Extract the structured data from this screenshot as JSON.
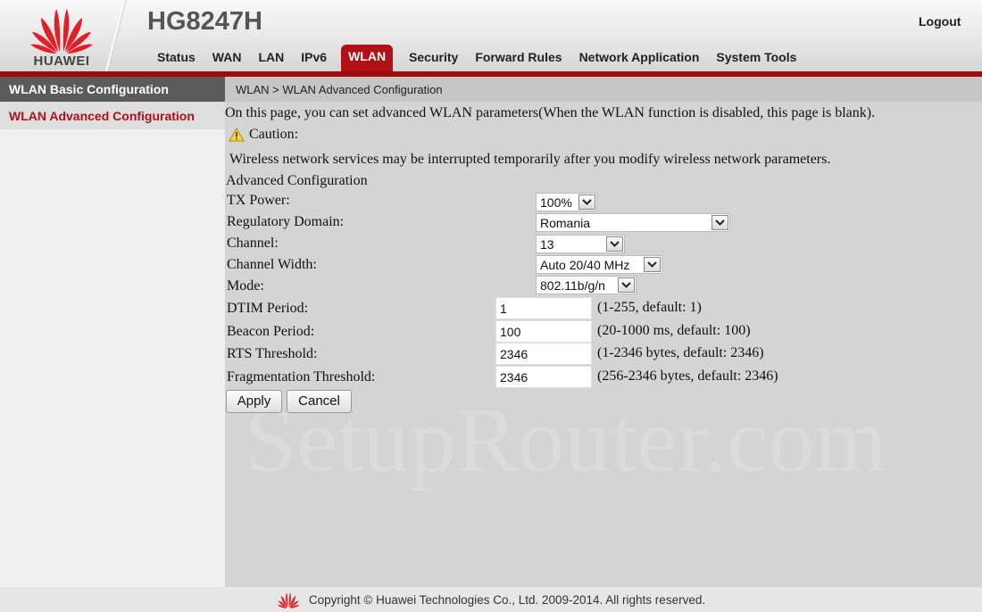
{
  "header": {
    "brand": "HUAWEI",
    "model": "HG8247H",
    "logout_label": "Logout"
  },
  "nav": {
    "items": [
      {
        "label": "Status",
        "active": false
      },
      {
        "label": "WAN",
        "active": false
      },
      {
        "label": "LAN",
        "active": false
      },
      {
        "label": "IPv6",
        "active": false
      },
      {
        "label": "WLAN",
        "active": true
      },
      {
        "label": "Security",
        "active": false
      },
      {
        "label": "Forward Rules",
        "active": false
      },
      {
        "label": "Network Application",
        "active": false
      },
      {
        "label": "System Tools",
        "active": false
      }
    ]
  },
  "sidebar": {
    "items": [
      {
        "label": "WLAN Basic Configuration"
      },
      {
        "label": "WLAN Advanced Configuration",
        "selected": true
      }
    ]
  },
  "breadcrumb": "WLAN > WLAN Advanced Configuration",
  "page": {
    "intro": "On this page, you can set advanced WLAN parameters(When the WLAN function is disabled, this page is blank).",
    "caution_label": "Caution:",
    "caution_icon": "warning-triangle-icon",
    "caution_text": "Wireless network services may be interrupted temporarily after you modify wireless network parameters.",
    "section_title": "Advanced Configuration"
  },
  "form": {
    "tx_power": {
      "label": "TX Power:",
      "value": "100%"
    },
    "regulatory_domain": {
      "label": "Regulatory Domain:",
      "value": "Romania"
    },
    "channel": {
      "label": "Channel:",
      "value": "13"
    },
    "channel_width": {
      "label": "Channel Width:",
      "value": "Auto 20/40 MHz"
    },
    "mode": {
      "label": "Mode:",
      "value": "802.11b/g/n"
    },
    "dtim_period": {
      "label": "DTIM Period:",
      "value": "1",
      "hint": "(1-255, default: 1)"
    },
    "beacon_period": {
      "label": "Beacon Period:",
      "value": "100",
      "hint": "(20-1000 ms, default: 100)"
    },
    "rts_threshold": {
      "label": "RTS Threshold:",
      "value": "2346",
      "hint": "(1-2346 bytes, default: 2346)"
    },
    "frag_threshold": {
      "label": "Fragmentation Threshold:",
      "value": "2346",
      "hint": "(256-2346 bytes, default: 2346)"
    },
    "apply_label": "Apply",
    "cancel_label": "Cancel"
  },
  "watermark": "SetupRouter.com",
  "footer": {
    "copyright": "Copyright © Huawei Technologies Co., Ltd. 2009-2014. All rights reserved."
  },
  "colors": {
    "brand_red": "#b11116",
    "header_bar": "#9e0b0f",
    "sidebar_head": "#5b5b5b"
  }
}
